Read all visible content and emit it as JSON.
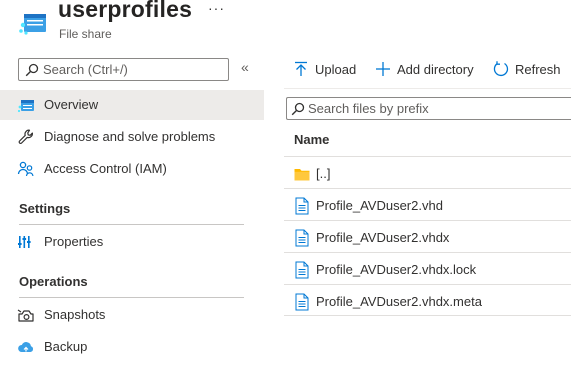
{
  "header": {
    "title": "userprofiles",
    "subtitle": "File share",
    "more_label": "···",
    "resource_icon": "file-share-icon",
    "accent_color": "#0078d4"
  },
  "sidebar": {
    "search_placeholder": "Search (Ctrl+/)",
    "collapse_label": "«",
    "items": [
      {
        "label": "Overview",
        "icon": "overview-icon",
        "selected": true
      },
      {
        "label": "Diagnose and solve problems",
        "icon": "wrench-icon"
      },
      {
        "label": "Access Control (IAM)",
        "icon": "people-icon"
      }
    ],
    "sections": [
      {
        "title": "Settings",
        "items": [
          {
            "label": "Properties",
            "icon": "properties-icon"
          }
        ]
      },
      {
        "title": "Operations",
        "items": [
          {
            "label": "Snapshots",
            "icon": "snapshot-icon"
          },
          {
            "label": "Backup",
            "icon": "backup-icon"
          }
        ]
      }
    ]
  },
  "toolbar": {
    "upload_label": "Upload",
    "add_directory_label": "Add directory",
    "refresh_label": "Refresh"
  },
  "files": {
    "search_placeholder": "Search files by prefix",
    "column_name": "Name",
    "rows": [
      {
        "name": "[..]",
        "type": "folder"
      },
      {
        "name": "Profile_AVDuser2.vhd",
        "type": "file"
      },
      {
        "name": "Profile_AVDuser2.vhdx",
        "type": "file"
      },
      {
        "name": "Profile_AVDuser2.vhdx.lock",
        "type": "file"
      },
      {
        "name": "Profile_AVDuser2.vhdx.meta",
        "type": "file"
      }
    ]
  }
}
